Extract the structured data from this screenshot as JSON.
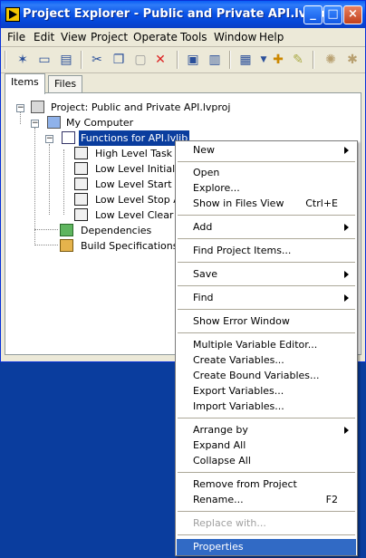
{
  "window": {
    "title": "Project Explorer - Public and Private API.lvproj",
    "minimize": "_",
    "maximize": "□",
    "close": "×"
  },
  "menubar": [
    {
      "label": "File"
    },
    {
      "label": "Edit"
    },
    {
      "label": "View"
    },
    {
      "label": "Project"
    },
    {
      "label": "Operate"
    },
    {
      "label": "Tools"
    },
    {
      "label": "Window"
    },
    {
      "label": "Help"
    }
  ],
  "toolbar_icons": [
    "new-icon",
    "open-icon",
    "save-all-icon",
    "cut-icon",
    "copy-icon",
    "paste-icon",
    "delete-icon",
    "build-icon",
    "deploy-icon",
    "view-icon",
    "filter-icon",
    "settings-icon",
    "ring-icon",
    "gear-icon"
  ],
  "tabs": [
    {
      "label": "Items"
    },
    {
      "label": "Files"
    }
  ],
  "tree": {
    "project": "Project: Public and Private API.lvproj",
    "computer": "My Computer",
    "library": "Functions for API.lvlib",
    "vis": [
      "High Level Task of",
      "Low Level Initialize",
      "Low Level Start Ac",
      "Low Level Stop Ac",
      "Low Level Clear Ta"
    ],
    "dependencies": "Dependencies",
    "build": "Build Specifications"
  },
  "context_menu": {
    "new": "New",
    "open": "Open",
    "explore": "Explore...",
    "show_files": "Show in Files View",
    "show_files_shortcut": "Ctrl+E",
    "add": "Add",
    "find_items": "Find Project Items...",
    "save": "Save",
    "find": "Find",
    "show_error": "Show Error Window",
    "multi_var": "Multiple Variable Editor...",
    "create_vars": "Create Variables...",
    "create_bound": "Create Bound Variables...",
    "export_vars": "Export Variables...",
    "import_vars": "Import Variables...",
    "arrange_by": "Arrange by",
    "expand_all": "Expand All",
    "collapse_all": "Collapse All",
    "remove": "Remove from Project",
    "rename": "Rename...",
    "rename_shortcut": "F2",
    "replace_with": "Replace with...",
    "properties": "Properties"
  }
}
